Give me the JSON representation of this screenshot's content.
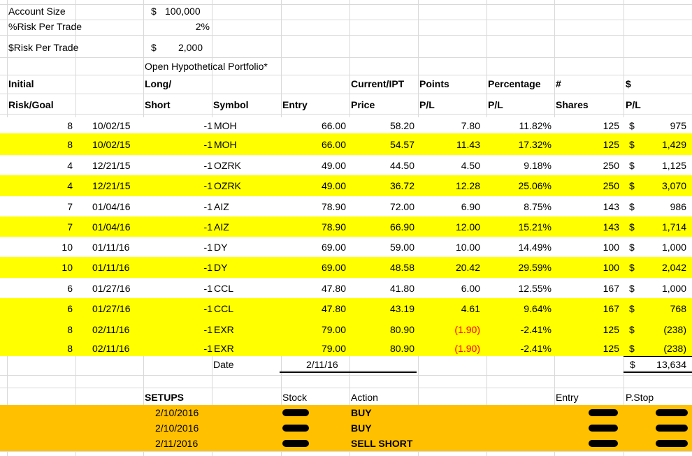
{
  "header": {
    "account_size_label": "Account Size",
    "account_size_currency": "$",
    "account_size_value": "100,000",
    "risk_pct_label": "%Risk Per Trade",
    "risk_pct_value": "2%",
    "risk_dollar_label": "$Risk Per Trade",
    "risk_dollar_currency": "$",
    "risk_dollar_value": "2,000",
    "portfolio_title": "Open Hypothetical Portfolio*"
  },
  "columns": {
    "initial": "Initial",
    "risk_goal": "Risk/Goal",
    "long": "Long/",
    "short": "Short",
    "symbol": "Symbol",
    "entry": "Entry",
    "current_ipt": "Current/IPT",
    "price": "Price",
    "points": "Points",
    "points_pl": "P/L",
    "percentage": "Percentage",
    "percentage_pl": "P/L",
    "hash": "#",
    "shares": "Shares",
    "dollar": "$",
    "dollar_pl": "P/L"
  },
  "trades": [
    {
      "risk": "8",
      "date": "10/02/15",
      "dir": "-1",
      "symbol": "MOH",
      "entry": "66.00",
      "price": "58.20",
      "points": "7.80",
      "pct": "11.82%",
      "shares": "125",
      "cur": "$",
      "pl": "975",
      "hl": false,
      "neg": false
    },
    {
      "risk": "8",
      "date": "10/02/15",
      "dir": "-1",
      "symbol": "MOH",
      "entry": "66.00",
      "price": "54.57",
      "points": "11.43",
      "pct": "17.32%",
      "shares": "125",
      "cur": "$",
      "pl": "1,429",
      "hl": true,
      "neg": false
    },
    {
      "risk": "4",
      "date": "12/21/15",
      "dir": "-1",
      "symbol": "OZRK",
      "entry": "49.00",
      "price": "44.50",
      "points": "4.50",
      "pct": "9.18%",
      "shares": "250",
      "cur": "$",
      "pl": "1,125",
      "hl": false,
      "neg": false
    },
    {
      "risk": "4",
      "date": "12/21/15",
      "dir": "-1",
      "symbol": "OZRK",
      "entry": "49.00",
      "price": "36.72",
      "points": "12.28",
      "pct": "25.06%",
      "shares": "250",
      "cur": "$",
      "pl": "3,070",
      "hl": true,
      "neg": false
    },
    {
      "risk": "7",
      "date": "01/04/16",
      "dir": "-1",
      "symbol": "AIZ",
      "entry": "78.90",
      "price": "72.00",
      "points": "6.90",
      "pct": "8.75%",
      "shares": "143",
      "cur": "$",
      "pl": "986",
      "hl": false,
      "neg": false
    },
    {
      "risk": "7",
      "date": "01/04/16",
      "dir": "-1",
      "symbol": "AIZ",
      "entry": "78.90",
      "price": "66.90",
      "points": "12.00",
      "pct": "15.21%",
      "shares": "143",
      "cur": "$",
      "pl": "1,714",
      "hl": true,
      "neg": false
    },
    {
      "risk": "10",
      "date": "01/11/16",
      "dir": "-1",
      "symbol": "DY",
      "entry": "69.00",
      "price": "59.00",
      "points": "10.00",
      "pct": "14.49%",
      "shares": "100",
      "cur": "$",
      "pl": "1,000",
      "hl": false,
      "neg": false
    },
    {
      "risk": "10",
      "date": "01/11/16",
      "dir": "-1",
      "symbol": "DY",
      "entry": "69.00",
      "price": "48.58",
      "points": "20.42",
      "pct": "29.59%",
      "shares": "100",
      "cur": "$",
      "pl": "2,042",
      "hl": true,
      "neg": false
    },
    {
      "risk": "6",
      "date": "01/27/16",
      "dir": "-1",
      "symbol": "CCL",
      "entry": "47.80",
      "price": "41.80",
      "points": "6.00",
      "pct": "12.55%",
      "shares": "167",
      "cur": "$",
      "pl": "1,000",
      "hl": false,
      "neg": false
    },
    {
      "risk": "6",
      "date": "01/27/16",
      "dir": "-1",
      "symbol": "CCL",
      "entry": "47.80",
      "price": "43.19",
      "points": "4.61",
      "pct": "9.64%",
      "shares": "167",
      "cur": "$",
      "pl": "768",
      "hl": true,
      "neg": false
    },
    {
      "risk": "8",
      "date": "02/11/16",
      "dir": "-1",
      "symbol": "EXR",
      "entry": "79.00",
      "price": "80.90",
      "points": "(1.90)",
      "pct": "-2.41%",
      "shares": "125",
      "cur": "$",
      "pl": "(238)",
      "hl": true,
      "neg": true
    },
    {
      "risk": "8",
      "date": "02/11/16",
      "dir": "-1",
      "symbol": "EXR",
      "entry": "79.00",
      "price": "80.90",
      "points": "(1.90)",
      "pct": "-2.41%",
      "shares": "125",
      "cur": "$",
      "pl": "(238)",
      "hl": true,
      "neg": true
    }
  ],
  "summary": {
    "date_label": "Date",
    "date_value": "2/11/16",
    "total_currency": "$",
    "total_value": "13,634"
  },
  "setups": {
    "title": "SETUPS",
    "stock_header": "Stock",
    "action_header": "Action",
    "entry_header": "Entry",
    "pstop_header": "P.Stop",
    "rows": [
      {
        "date": "2/10/2016",
        "action": "BUY"
      },
      {
        "date": "2/10/2016",
        "action": "BUY"
      },
      {
        "date": "2/11/2016",
        "action": "SELL SHORT"
      }
    ]
  },
  "colors": {
    "highlight": "#ffff00",
    "setups_band": "#ffc000",
    "negative": "#ff0000",
    "gridline": "#d9d9d9"
  }
}
